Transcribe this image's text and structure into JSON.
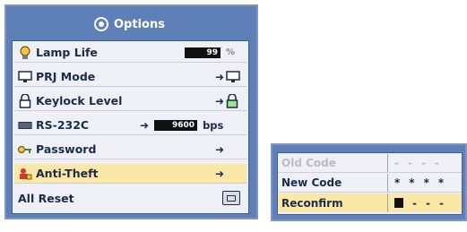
{
  "menu": {
    "title": "Options",
    "title_icon": "gear-icon",
    "items": [
      {
        "label": "Lamp Life",
        "icon": "lamp-icon",
        "value": "99",
        "unit": "%"
      },
      {
        "label": "PRJ Mode",
        "icon": "projector-icon",
        "value_icon": "projector-icon"
      },
      {
        "label": "Keylock Level",
        "icon": "lock-icon",
        "value_icon": "lock-icon"
      },
      {
        "label": "RS-232C",
        "icon": "rs232c-icon",
        "value": "9600",
        "unit": "bps"
      },
      {
        "label": "Password",
        "icon": "key-icon"
      },
      {
        "label": "Anti-Theft",
        "icon": "anti-theft-icon",
        "selected": true
      },
      {
        "label": "All Reset",
        "icon": "",
        "value_icon": "reset-icon"
      }
    ],
    "arrow": "➜"
  },
  "antitheft": {
    "rows": [
      {
        "label": "Old Code",
        "code": [
          "-",
          "-",
          "-",
          "-"
        ],
        "disabled": true
      },
      {
        "label": "New Code",
        "code": [
          "*",
          "*",
          "*",
          "*"
        ]
      },
      {
        "label": "Reconfirm",
        "code": [
          "▮",
          "-",
          "-",
          "-"
        ],
        "selected": true
      }
    ]
  },
  "colors": {
    "panel": "#5e7fb8",
    "list_bg": "#eef0f5",
    "selected": "#fbe7a6",
    "text": "#1b2b4a",
    "disabled_text": "#b7bcc7"
  }
}
